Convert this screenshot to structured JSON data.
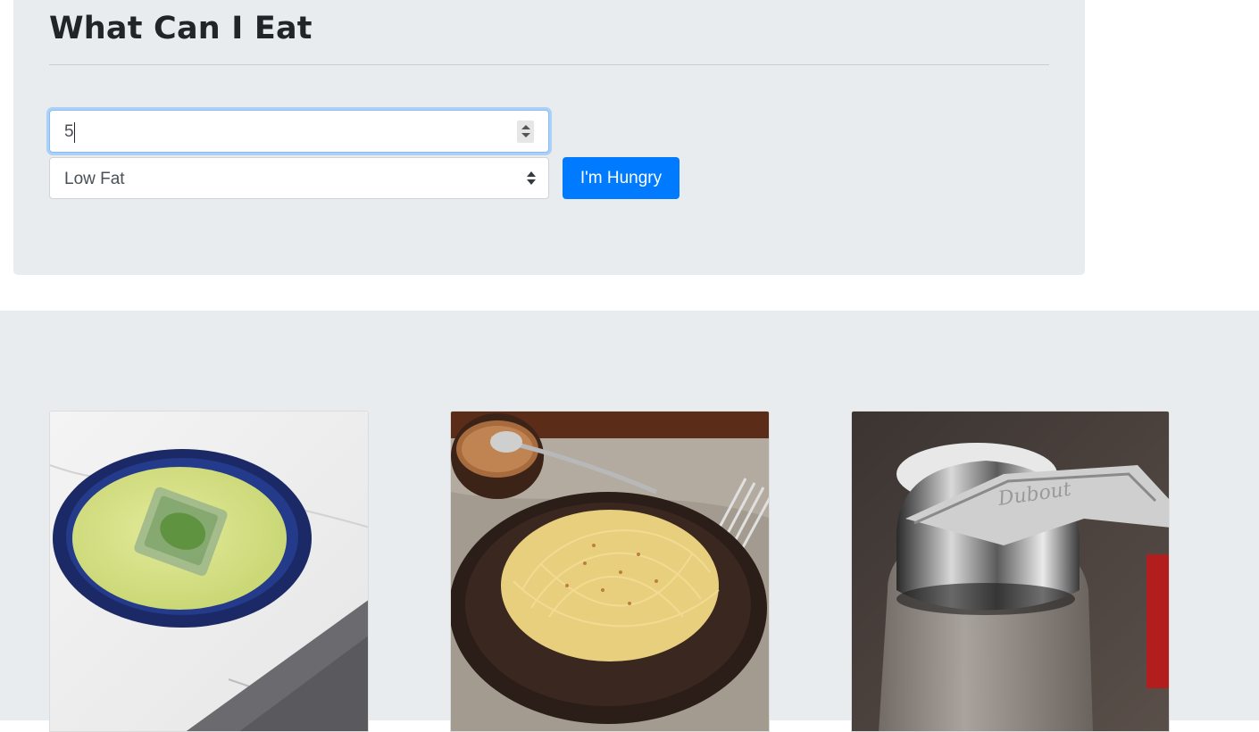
{
  "header": {
    "title": "What Can I Eat"
  },
  "form": {
    "count_value": "5",
    "diet_select": {
      "selected": "Low Fat"
    },
    "submit_label": "I'm Hungry"
  },
  "results": {
    "cards": [
      {
        "image": "green-soup-bowl-photo"
      },
      {
        "image": "spaghetti-plate-photo"
      },
      {
        "image": "glass-dispenser-jar-photo"
      }
    ]
  },
  "colors": {
    "primary": "#007bff",
    "jumbotron_bg": "#e9ecef",
    "focus_border": "#80bdff"
  }
}
